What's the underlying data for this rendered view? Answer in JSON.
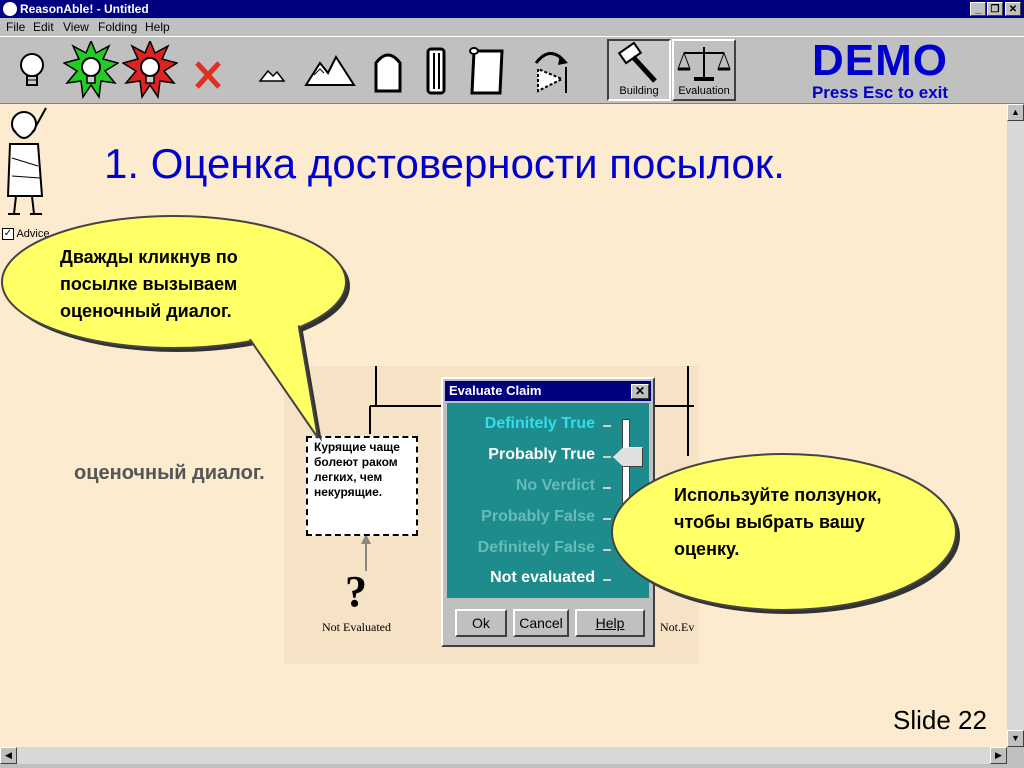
{
  "window": {
    "title": "ReasonAble! - Untitled",
    "controls": [
      "_",
      "❐",
      "✕"
    ]
  },
  "menu": [
    "File",
    "Edit",
    "View",
    "Folding",
    "Help"
  ],
  "toolbar": {
    "tools": [
      "bulb-icon",
      "green-bulb-icon",
      "red-bulb-icon",
      "red-x-icon",
      "small-mountain-icon",
      "mountains-icon",
      "gravestone-icon",
      "pillar-icon",
      "scroll-icon",
      "rotate-icon"
    ],
    "modes": [
      {
        "label": "Building",
        "icon": "hammer-icon"
      },
      {
        "label": "Evaluation",
        "icon": "scales-icon"
      }
    ],
    "demo": "DEMO",
    "demo_hint": "Press Esc to exit"
  },
  "advice": {
    "label": "Advice",
    "checked": true
  },
  "slide": {
    "title": "1. Оценка достоверности посылок.",
    "number": "Slide 22"
  },
  "diagram": {
    "claim_text": "Курящие чаще болеют раком легких, чем некурящие.",
    "left_status": "Not Evaluated",
    "right_status": "Not.Ev",
    "hidden_text_fragment": "оценочный диалог."
  },
  "dialog": {
    "title": "Evaluate Claim",
    "options": [
      {
        "label": "Definitely True",
        "color": "#33ddee"
      },
      {
        "label": "Probably True",
        "color": "#ffffff"
      },
      {
        "label": "No Verdict",
        "color": "#66bbbb"
      },
      {
        "label": "Probably False",
        "color": "#66bbbb"
      },
      {
        "label": "Definitely False",
        "color": "#66bbbb"
      },
      {
        "label": "Not evaluated",
        "color": "#ffffff"
      }
    ],
    "selected": "Probably True",
    "buttons": {
      "ok": "Ok",
      "cancel": "Cancel",
      "help": "Help"
    }
  },
  "bubbles": {
    "left": "Дважды кликнув по посылке вызываем оценочный диалог.",
    "right": "Используйте ползунок, чтобы выбрать вашу оценку."
  },
  "colors": {
    "title_blue": "#0000cc",
    "bubble_fill": "#ffff66",
    "slide_bg": "#fdebd0",
    "dialog_panel": "#1e8c8c"
  }
}
